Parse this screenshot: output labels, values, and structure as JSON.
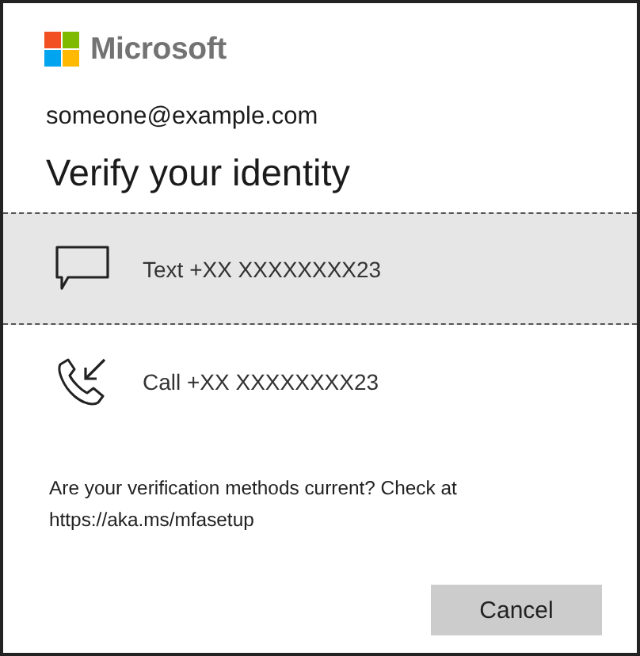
{
  "brand": {
    "name": "Microsoft"
  },
  "account": "someone@example.com",
  "title": "Verify your identity",
  "options": [
    {
      "kind": "text",
      "label": "Text +XX XXXXXXXX23",
      "selected": true
    },
    {
      "kind": "call",
      "label": "Call +XX XXXXXXXX23",
      "selected": false
    }
  ],
  "note": "Are your verification methods current? Check at https://aka.ms/mfasetup",
  "buttons": [
    {
      "label": "Cancel"
    }
  ]
}
